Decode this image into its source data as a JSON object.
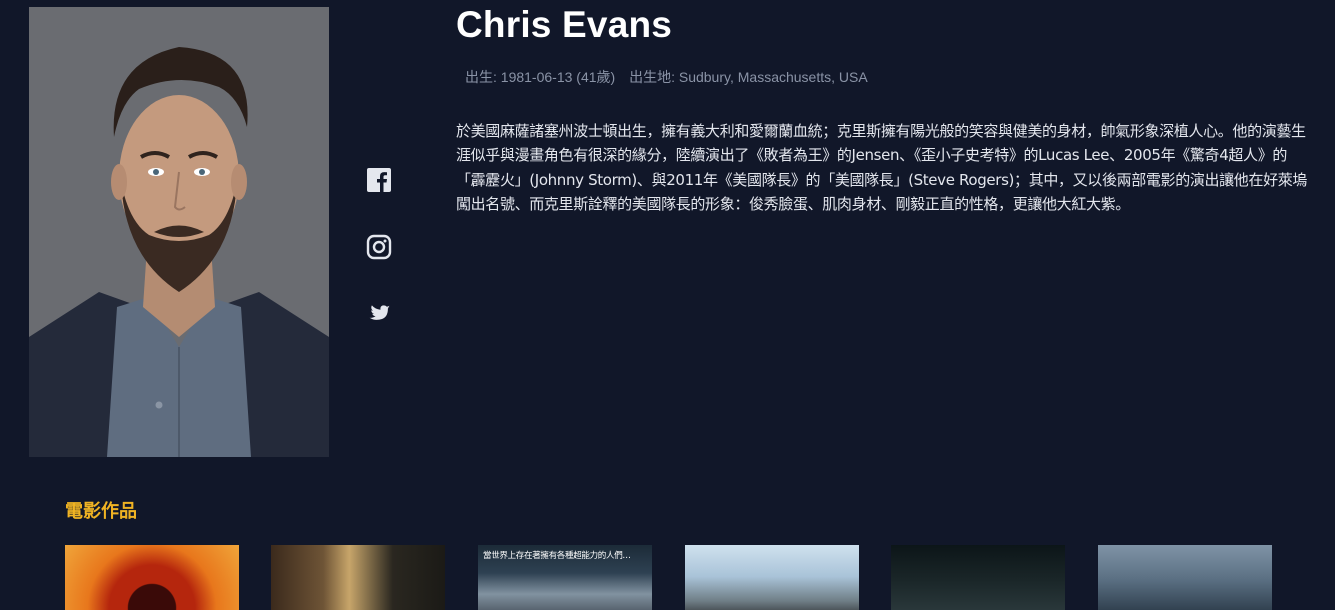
{
  "actor": {
    "name": "Chris Evans",
    "birth": "出生: 1981-06-13 (41歲)",
    "birthplace": "出生地: Sudbury, Massachusetts, USA",
    "bio": "於美國麻薩諸塞州波士頓出生，擁有義大利和愛爾蘭血統；克里斯擁有陽光般的笑容與健美的身材，帥氣形象深植人心。他的演藝生涯似乎與漫畫角色有很深的緣分，陸續演出了《敗者為王》的Jensen、《歪小子史考特》的Lucas Lee、2005年《驚奇4超人》的「霹靂火」(Johnny Storm)、與2011年《美國隊長》的「美國隊長」(Steve Rogers)；其中，又以後兩部電影的演出讓他在好萊塢闖出名號、而克里斯詮釋的美國隊長的形象：俊秀臉蛋、肌肉身材、剛毅正直的性格，更讓他大紅大紫。"
  },
  "social": [
    {
      "icon": "facebook-icon"
    },
    {
      "icon": "instagram-icon"
    },
    {
      "icon": "twitter-icon"
    }
  ],
  "filmography": {
    "title": "電影作品",
    "posters": [
      {
        "tagline": ""
      },
      {
        "tagline": ""
      },
      {
        "tagline": "當世界上存在著擁有各種超能力的人們…"
      },
      {
        "tagline": ""
      },
      {
        "tagline": ""
      },
      {
        "tagline": ""
      }
    ]
  },
  "colors": {
    "background": "#111729",
    "accent": "#f0b323",
    "meta_text": "#8a93a6"
  }
}
